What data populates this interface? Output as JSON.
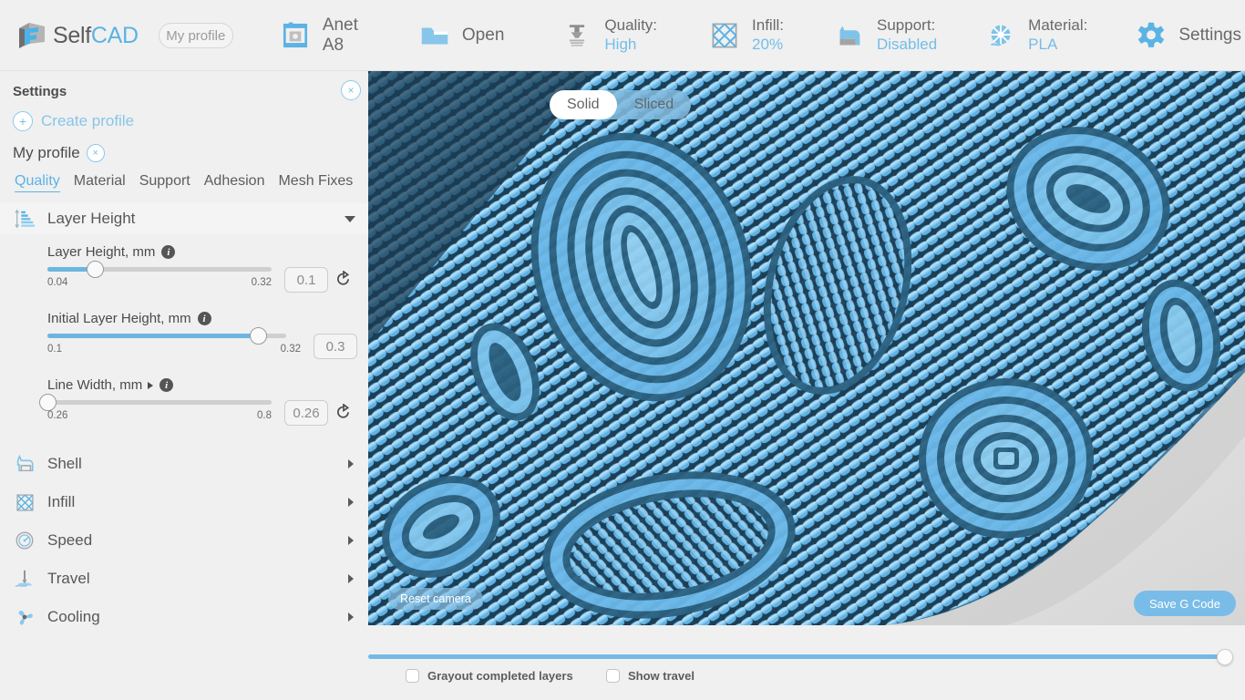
{
  "app": {
    "brand_self": "Self",
    "brand_cad": "CAD",
    "profile_placeholder": "My profile"
  },
  "toolbar": {
    "items": [
      {
        "icon": "printer-icon",
        "label": "Anet A8",
        "value": "",
        "single": true
      },
      {
        "icon": "folder-open-icon",
        "label": "Open",
        "value": "",
        "single": true
      },
      {
        "icon": "quality-nozzle-icon",
        "label": "Quality:",
        "value": "High",
        "single": false
      },
      {
        "icon": "infill-grid-icon",
        "label": "Infill:",
        "value": "20%",
        "single": false
      },
      {
        "icon": "support-dog-icon",
        "label": "Support:",
        "value": "Disabled",
        "single": false
      },
      {
        "icon": "material-spool-icon",
        "label": "Material:",
        "value": "PLA",
        "single": false
      },
      {
        "icon": "gear-icon",
        "label": "Settings",
        "value": "",
        "single": true
      }
    ]
  },
  "panel": {
    "title": "Settings",
    "close_label": "×",
    "create_profile": "Create profile",
    "create_icon": "+",
    "profile_name": "My profile",
    "profile_remove": "×",
    "tabs": [
      {
        "label": "Quality",
        "active": true
      },
      {
        "label": "Material",
        "active": false
      },
      {
        "label": "Support",
        "active": false
      },
      {
        "label": "Adhesion",
        "active": false
      },
      {
        "label": "Mesh Fixes",
        "active": false
      }
    ],
    "sections": [
      {
        "name": "Layer Height",
        "icon": "layer-height-icon",
        "expanded": true
      },
      {
        "name": "Shell",
        "icon": "shell-dog-icon",
        "expanded": false
      },
      {
        "name": "Infill",
        "icon": "infill-grid-icon",
        "expanded": false
      },
      {
        "name": "Speed",
        "icon": "speed-gauge-icon",
        "expanded": false
      },
      {
        "name": "Travel",
        "icon": "travel-nozzle-icon",
        "expanded": false
      },
      {
        "name": "Cooling",
        "icon": "cooling-fan-icon",
        "expanded": false
      }
    ],
    "fields": [
      {
        "label": "Layer Height, mm",
        "min": "0.04",
        "max": "0.32",
        "value": "0.1",
        "fill_pct": 21,
        "has_reset": true,
        "has_expand": false
      },
      {
        "label": "Initial Layer Height, mm",
        "min": "0.1",
        "max": "0.32",
        "value": "0.3",
        "fill_pct": 88,
        "has_reset": false,
        "has_expand": false
      },
      {
        "label": "Line Width, mm",
        "min": "0.26",
        "max": "0.8",
        "value": "0.26",
        "fill_pct": 0,
        "has_reset": true,
        "has_expand": true
      }
    ]
  },
  "viewport": {
    "toggle": [
      {
        "label": "Solid",
        "active": true
      },
      {
        "label": "Sliced",
        "active": false
      }
    ],
    "reset_camera": "Reset camera",
    "save_gcode": "Save G Code"
  },
  "bottom": {
    "layer_slider_pct": 100,
    "checkboxes": [
      {
        "label": "Grayout completed layers",
        "checked": false
      },
      {
        "label": "Show travel",
        "checked": false
      }
    ]
  },
  "colors": {
    "accent": "#5bb3e4",
    "accent_soft": "#79bce8",
    "text": "#5d5d5d",
    "panel_bg": "#f0f0f0",
    "filament": "#6cb8e8",
    "filament_dark": "#1d3f55"
  }
}
